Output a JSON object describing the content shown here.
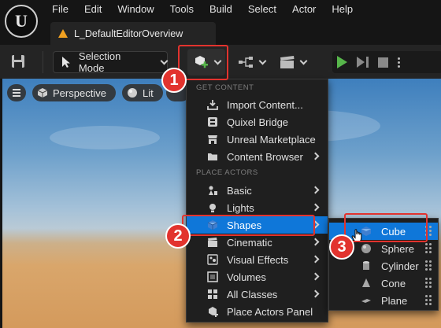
{
  "app": {
    "logo_text": "U",
    "menu": [
      "File",
      "Edit",
      "Window",
      "Tools",
      "Build",
      "Select",
      "Actor",
      "Help"
    ],
    "document_tab": "L_DefaultEditorOverview"
  },
  "toolbar": {
    "selection_mode_label": "Selection Mode"
  },
  "viewport": {
    "perspective_label": "Perspective",
    "lit_label": "Lit"
  },
  "add_menu": {
    "section_content": "GET CONTENT",
    "section_actors": "PLACE ACTORS",
    "items": [
      {
        "label": "Import Content...",
        "icon": "import-icon",
        "submenu": false
      },
      {
        "label": "Quixel Bridge",
        "icon": "bridge-icon",
        "submenu": false
      },
      {
        "label": "Unreal Marketplace",
        "icon": "marketplace-icon",
        "submenu": false
      },
      {
        "label": "Content Browser",
        "icon": "folder-icon",
        "submenu": true
      },
      {
        "label": "Basic",
        "icon": "basic-icon",
        "submenu": true
      },
      {
        "label": "Lights",
        "icon": "light-icon",
        "submenu": true
      },
      {
        "label": "Shapes",
        "icon": "cube-icon",
        "submenu": true,
        "active": true
      },
      {
        "label": "Cinematic",
        "icon": "film-icon",
        "submenu": true
      },
      {
        "label": "Visual Effects",
        "icon": "effects-icon",
        "submenu": true
      },
      {
        "label": "Volumes",
        "icon": "volume-icon",
        "submenu": true
      },
      {
        "label": "All Classes",
        "icon": "classes-icon",
        "submenu": true
      },
      {
        "label": "Place Actors Panel",
        "icon": "place-actors-icon",
        "submenu": false
      }
    ]
  },
  "shapes_menu": {
    "items": [
      {
        "label": "Cube",
        "icon": "cube-icon",
        "active": true
      },
      {
        "label": "Sphere",
        "icon": "sphere-icon"
      },
      {
        "label": "Cylinder",
        "icon": "cylinder-icon"
      },
      {
        "label": "Cone",
        "icon": "cone-icon"
      },
      {
        "label": "Plane",
        "icon": "plane-icon"
      }
    ]
  },
  "annotations": {
    "markers": [
      "1",
      "2",
      "3"
    ],
    "highlight_color": "#e2332e"
  },
  "colors": {
    "accent": "#0f77d9",
    "play_green": "#57b64b"
  }
}
